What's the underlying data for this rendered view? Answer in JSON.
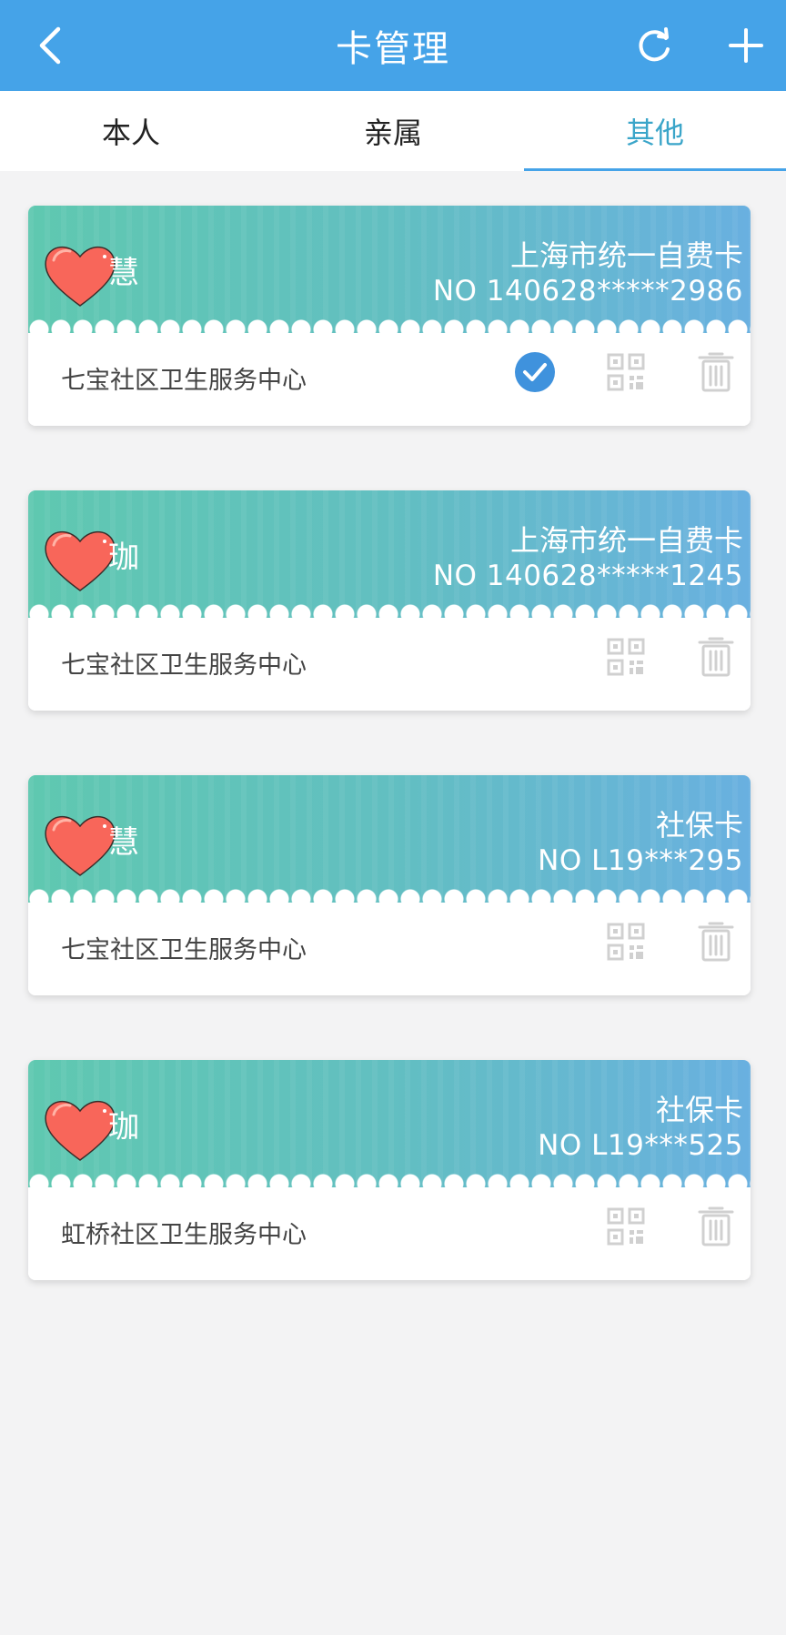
{
  "header": {
    "title": "卡管理",
    "back_icon": "chevron-left-icon",
    "refresh_icon": "refresh-icon",
    "add_icon": "plus-icon",
    "background_color": "#45a3e8"
  },
  "tabs": [
    {
      "label": "本人",
      "active": false
    },
    {
      "label": "亲属",
      "active": false
    },
    {
      "label": "其他",
      "active": true
    }
  ],
  "cards": [
    {
      "logo_char": "慧",
      "type": "上海市统一自费卡",
      "number": "NO 140628*****2986",
      "org": "七宝社区卫生服务中心",
      "selected": true
    },
    {
      "logo_char": "珈",
      "type": "上海市统一自费卡",
      "number": "NO 140628*****1245",
      "org": "七宝社区卫生服务中心",
      "selected": false
    },
    {
      "logo_char": "慧",
      "type": "社保卡",
      "number": "NO L19***295",
      "org": "七宝社区卫生服务中心",
      "selected": false
    },
    {
      "logo_char": "珈",
      "type": "社保卡",
      "number": "NO L19***525",
      "org": "虹桥社区卫生服务中心",
      "selected": false
    }
  ],
  "colors": {
    "accent": "#45a3e8",
    "active_tab_text": "#3aa5c9",
    "check": "#3f92dd",
    "card_gradient_start": "#5fc8b0",
    "card_gradient_end": "#69b0e0",
    "heart": "#f8665a"
  }
}
